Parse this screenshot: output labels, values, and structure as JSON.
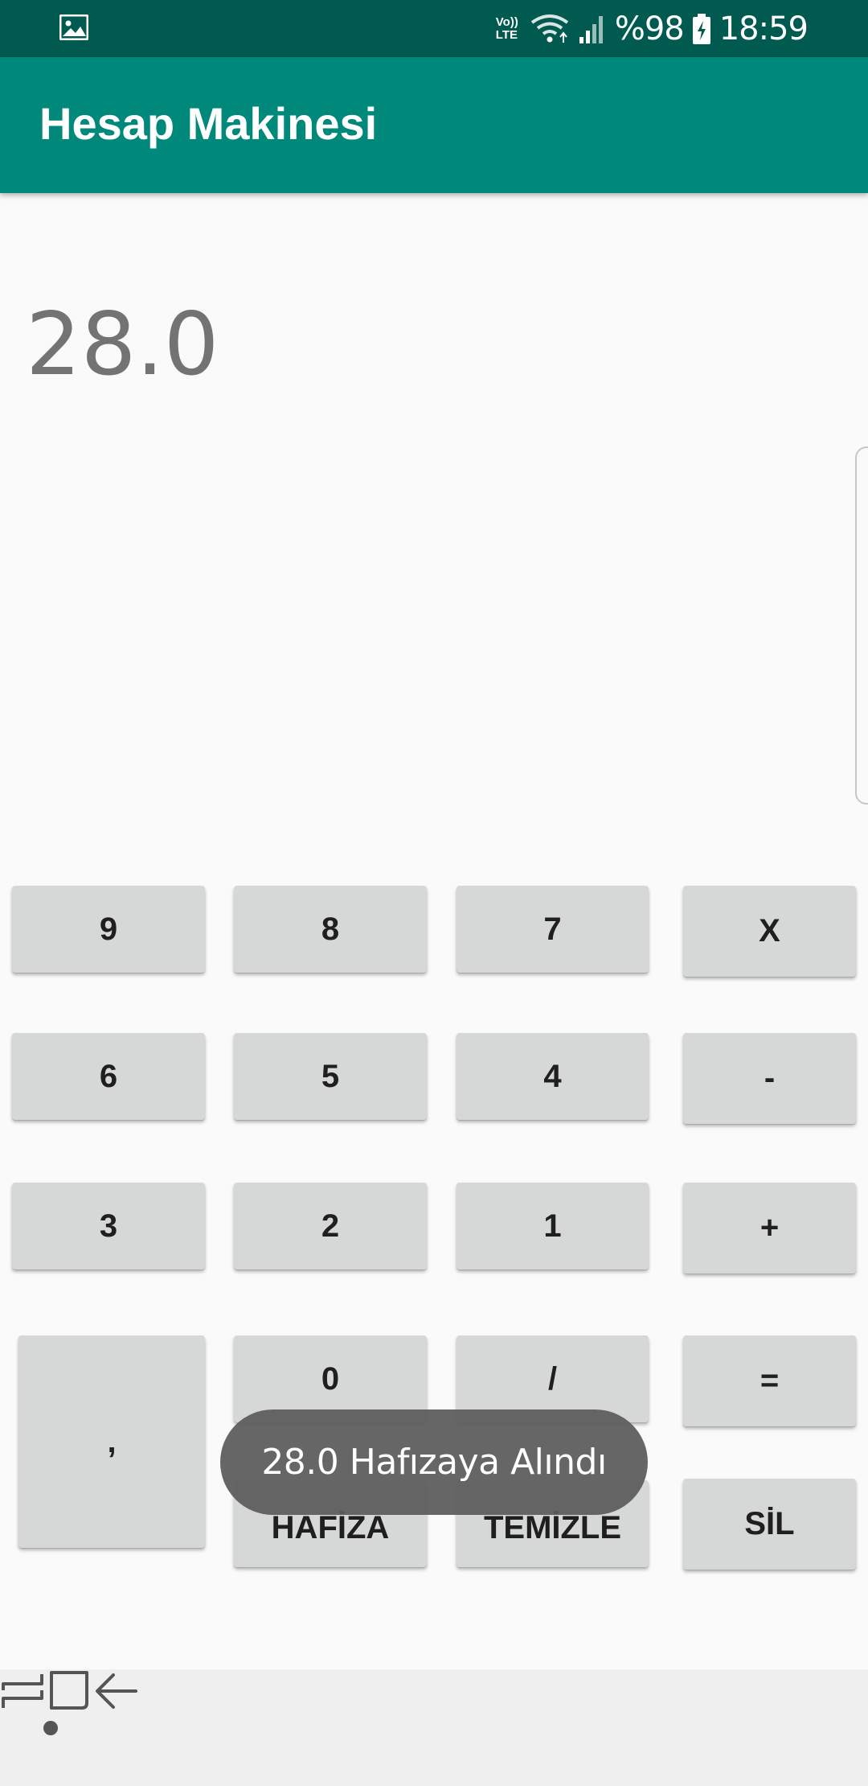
{
  "status_bar": {
    "lte_top": "Vo))",
    "lte_bottom": "LTE",
    "battery": "%98",
    "time": "18:59"
  },
  "app": {
    "title": "Hesap Makinesi",
    "toolbar_color": "#00897b",
    "status_bar_color": "#005a4f"
  },
  "display": {
    "value": "28.0"
  },
  "keypad": {
    "nine": "9",
    "eight": "8",
    "seven": "7",
    "multiply": "X",
    "six": "6",
    "five": "5",
    "four": "4",
    "minus": "-",
    "three": "3",
    "two": "2",
    "one": "1",
    "plus": "+",
    "comma": ",",
    "zero": "0",
    "divide": "/",
    "equals": "=",
    "memory": "HAFİZA",
    "clear": "TEMİZLE",
    "delete": "SİL"
  },
  "toast": {
    "message": "28.0 Hafızaya Alındı"
  },
  "nav_bar": {
    "icons": [
      "dot-icon",
      "recent-apps-icon",
      "home-icon",
      "back-icon"
    ]
  }
}
